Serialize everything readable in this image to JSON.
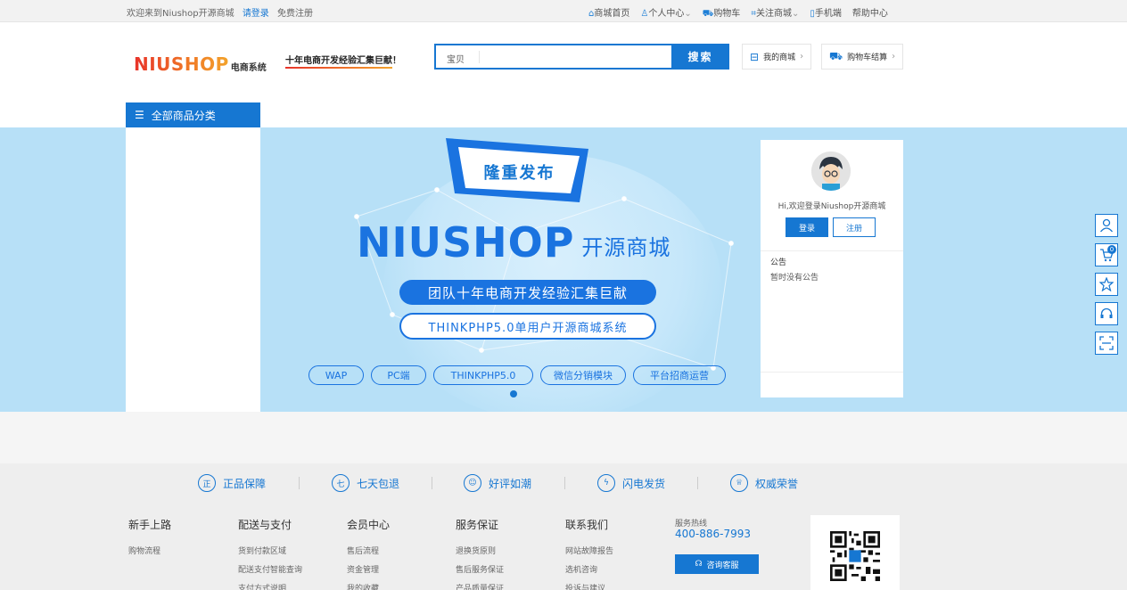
{
  "topbar": {
    "welcome": "欢迎来到Niushop开源商城",
    "login": "请登录",
    "register": "免费注册",
    "links": [
      "商城首页",
      "个人中心",
      "购物车",
      "关注商城",
      "手机端",
      "帮助中心"
    ]
  },
  "header": {
    "logo_brand": "NIUSHOP",
    "logo_sub": "电商系统",
    "slogan": "十年电商开发经验汇集巨献！",
    "search_tag": "宝贝",
    "search_value": "",
    "search_button": "搜索",
    "my_mall": "我的商城",
    "cart_checkout": "购物车结算",
    "all_categories": "全部商品分类"
  },
  "banner": {
    "tag": "隆重发布",
    "title": "NIUSHOP",
    "title_cn": "开源商城",
    "pill1": "团队十年电商开发经验汇集巨献",
    "pill2": "THINKPHP5.0单用户开源商城系统",
    "chips": [
      "WAP",
      "PC端",
      "THINKPHP5.0",
      "微信分销模块",
      "平台招商运营"
    ]
  },
  "userbox": {
    "welcome": "Hi,欢迎登录Niushop开源商城",
    "login": "登录",
    "register": "注册",
    "notice_title": "公告",
    "notice_empty": "暂时没有公告"
  },
  "sidebar": {
    "cart_count": "0"
  },
  "footer": {
    "guarantees": [
      {
        "icon": "正",
        "label": "正品保障"
      },
      {
        "icon": "七",
        "label": "七天包退"
      },
      {
        "icon": "☺",
        "label": "好评如潮"
      },
      {
        "icon": "ϟ",
        "label": "闪电发货"
      },
      {
        "icon": "♕",
        "label": "权威荣誉"
      }
    ],
    "columns": [
      {
        "title": "新手上路",
        "links": [
          "购物流程"
        ]
      },
      {
        "title": "配送与支付",
        "links": [
          "货到付款区域",
          "配送支付智能查询",
          "支付方式说明"
        ]
      },
      {
        "title": "会员中心",
        "links": [
          "售后流程",
          "资金管理",
          "我的收藏"
        ]
      },
      {
        "title": "服务保证",
        "links": [
          "退换货原则",
          "售后服务保证",
          "产品质量保证"
        ]
      },
      {
        "title": "联系我们",
        "links": [
          "网站故障报告",
          "选机咨询",
          "投诉与建议"
        ]
      }
    ],
    "hotline_title": "服务热线",
    "hotline": "400-886-7993",
    "consult": "咨询客服"
  },
  "colors": {
    "primary": "#1677d2",
    "banner_bg": "#b7e0f7",
    "logo_orange": "#f07b26"
  }
}
